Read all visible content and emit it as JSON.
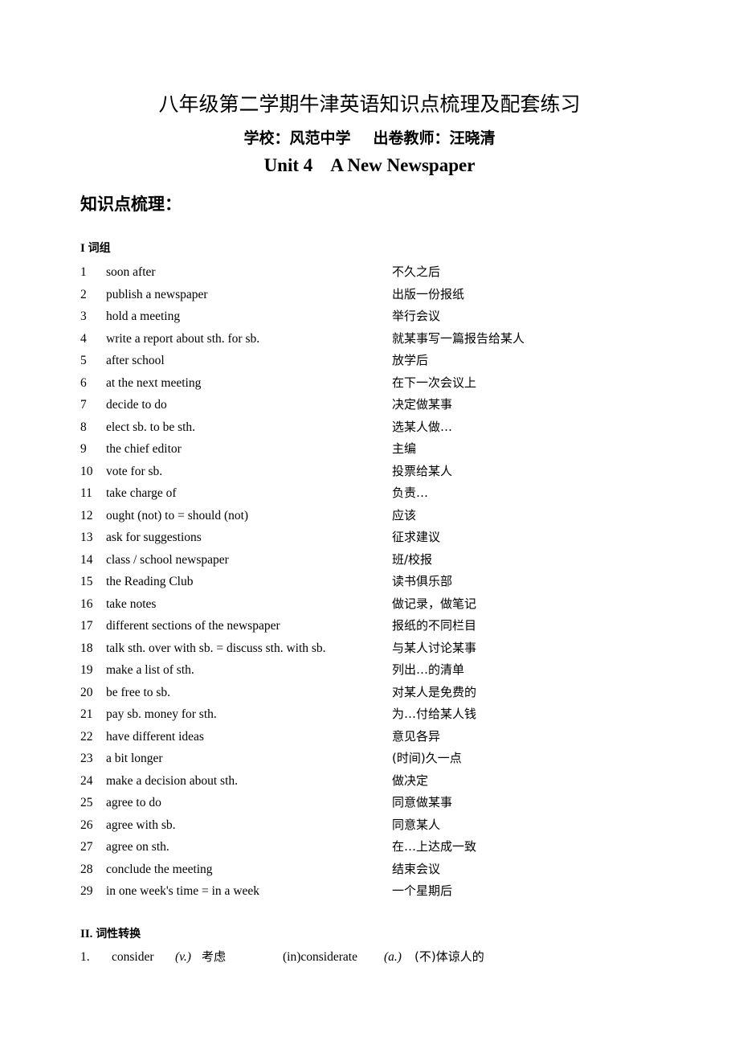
{
  "header": {
    "doc_title": "八年级第二学期牛津英语知识点梳理及配套练习",
    "school_label": "学校：风范中学",
    "teacher_label": "出卷教师：汪晓清",
    "unit_number": "Unit 4",
    "unit_name": "A New Newspaper"
  },
  "section": {
    "heading": "知识点梳理："
  },
  "groups": [
    {
      "roman": "I",
      "label": "词组"
    },
    {
      "roman": "II.",
      "label": "词性转换"
    }
  ],
  "phrases": [
    {
      "num": "1",
      "en": "soon after",
      "cn": "不久之后"
    },
    {
      "num": "2",
      "en": "publish a newspaper",
      "cn": "出版一份报纸"
    },
    {
      "num": "3",
      "en": "hold a meeting",
      "cn": "举行会议"
    },
    {
      "num": "4",
      "en": "write a report about sth. for sb.",
      "cn": "就某事写一篇报告给某人"
    },
    {
      "num": "5",
      "en": "after school",
      "cn": "放学后"
    },
    {
      "num": "6",
      "en": "at the next meeting",
      "cn": "在下一次会议上"
    },
    {
      "num": "7",
      "en": "decide to do",
      "cn": "决定做某事"
    },
    {
      "num": "8",
      "en": "elect sb. to be sth.",
      "cn": "选某人做…"
    },
    {
      "num": "9",
      "en": "the chief editor",
      "cn": "主编"
    },
    {
      "num": "10",
      "en": "vote for sb.",
      "cn": "投票给某人"
    },
    {
      "num": "11",
      "en": "take charge of",
      "cn": "负责…"
    },
    {
      "num": "12",
      "en": "ought (not) to = should (not)",
      "cn": "应该"
    },
    {
      "num": "13",
      "en": "ask for suggestions",
      "cn": "征求建议"
    },
    {
      "num": "14",
      "en": "class / school newspaper",
      "cn": "班/校报"
    },
    {
      "num": "15",
      "en": "the Reading Club",
      "cn": "读书俱乐部"
    },
    {
      "num": "16",
      "en": "take notes",
      "cn": "做记录，做笔记"
    },
    {
      "num": "17",
      "en": "different sections of the newspaper",
      "cn": "报纸的不同栏目"
    },
    {
      "num": "18",
      "en": "talk sth. over with sb. = discuss sth. with sb.",
      "cn": "与某人讨论某事"
    },
    {
      "num": "19",
      "en": "make a list of sth.",
      "cn": "列出…的清单"
    },
    {
      "num": "20",
      "en": "be free to sb.",
      "cn": "对某人是免费的"
    },
    {
      "num": "21",
      "en": "pay sb. money for sth.",
      "cn": "为…付给某人钱"
    },
    {
      "num": "22",
      "en": "have different ideas",
      "cn": "意见各异"
    },
    {
      "num": "23",
      "en": "a bit longer",
      "cn": "(时间)久一点"
    },
    {
      "num": "24",
      "en": "make a decision about sth.",
      "cn": "做决定"
    },
    {
      "num": "25",
      "en": "agree to do",
      "cn": "同意做某事"
    },
    {
      "num": "26",
      "en": "agree with sb.",
      "cn": "同意某人"
    },
    {
      "num": "27",
      "en": "agree on sth.",
      "cn": "在…上达成一致"
    },
    {
      "num": "28",
      "en": "conclude the meeting",
      "cn": "结束会议"
    },
    {
      "num": "29",
      "en": "in one week's time = in a week",
      "cn": "一个星期后"
    }
  ],
  "word_forms": [
    {
      "num": "1.",
      "base": "consider",
      "base_pos": "(v.)",
      "base_cn": "考虑",
      "derived": "(in)considerate",
      "derived_pos": "(a.)",
      "derived_cn": "(不)体谅人的"
    }
  ]
}
